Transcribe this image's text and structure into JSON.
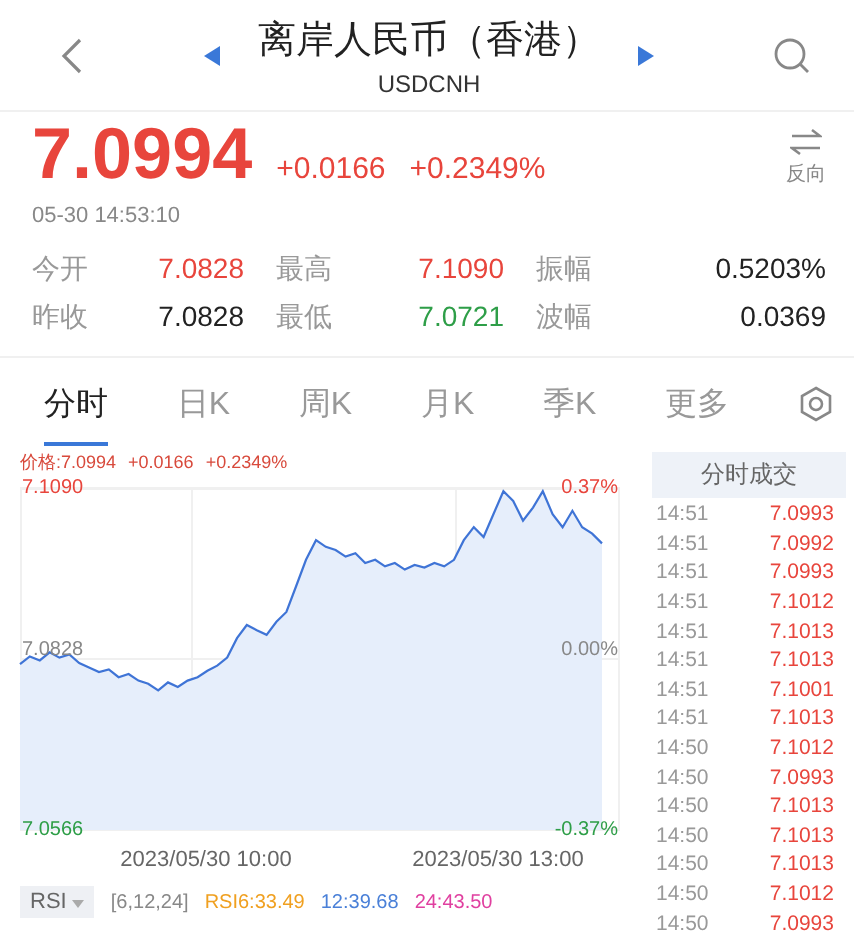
{
  "header": {
    "title": "离岸人民币（香港）",
    "code": "USDCNH"
  },
  "quote": {
    "price": "7.0994",
    "change": "+0.0166",
    "change_pct": "+0.2349%",
    "time": "05-30 14:53:10",
    "reverse_label": "反向"
  },
  "stats": [
    {
      "label": "今开",
      "value": "7.0828",
      "color": "#e8453c"
    },
    {
      "label": "最高",
      "value": "7.1090",
      "color": "#e8453c"
    },
    {
      "label": "振幅",
      "value": "0.5203%",
      "color": "#222222"
    },
    {
      "label": "昨收",
      "value": "7.0828",
      "color": "#222222"
    },
    {
      "label": "最低",
      "value": "7.0721",
      "color": "#2e9e48"
    },
    {
      "label": "波幅",
      "value": "0.0369",
      "color": "#222222"
    }
  ],
  "tabs": [
    {
      "label": "分时",
      "selected": true
    },
    {
      "label": "日K",
      "selected": false
    },
    {
      "label": "周K",
      "selected": false
    },
    {
      "label": "月K",
      "selected": false
    },
    {
      "label": "季K",
      "selected": false
    },
    {
      "label": "更多",
      "selected": false
    }
  ],
  "chart": {
    "info": "价格:7.0994",
    "info_change": "+0.0166",
    "info_pct": "+0.2349%",
    "high_pct": "0.37%",
    "mid_pct": "0.00%",
    "low_pct": "-0.37%",
    "time_labels": [
      "2023/05/30 10:00",
      "2023/05/30 13:00"
    ],
    "chart_data": {
      "type": "area",
      "ylim": [
        7.0566,
        7.109
      ],
      "yticks": [
        {
          "value": 7.0566,
          "label": "7.0566"
        },
        {
          "value": 7.0828,
          "label": "7.0828"
        },
        {
          "value": 7.109,
          "label": "7.1090"
        }
      ],
      "series": [
        {
          "color": "#3f74d6",
          "values": [
            7.082,
            7.0832,
            7.0826,
            7.0838,
            7.083,
            7.0835,
            7.0822,
            7.0815,
            7.0808,
            7.0812,
            7.08,
            7.0805,
            7.0795,
            7.079,
            7.078,
            7.0792,
            7.0785,
            7.0795,
            7.08,
            7.081,
            7.0818,
            7.083,
            7.086,
            7.088,
            7.0872,
            7.0865,
            7.0885,
            7.09,
            7.094,
            7.098,
            7.101,
            7.1,
            7.0995,
            7.0985,
            7.099,
            7.0975,
            7.098,
            7.097,
            7.0975,
            7.0965,
            7.0972,
            7.0968,
            7.0975,
            7.097,
            7.098,
            7.101,
            7.103,
            7.1015,
            7.105,
            7.1085,
            7.107,
            7.104,
            7.106,
            7.1085,
            7.105,
            7.103,
            7.1055,
            7.103,
            7.102,
            7.1005
          ]
        }
      ]
    }
  },
  "rsi": {
    "button": "RSI",
    "params": "[6,12,24]",
    "values": [
      {
        "text": "RSI6:33.49",
        "color": "#f0a020"
      },
      {
        "text": "12:39.68",
        "color": "#4a80d8"
      },
      {
        "text": "24:43.50",
        "color": "#e040a0"
      }
    ]
  },
  "trades": {
    "title": "分时成交",
    "rows": [
      {
        "time": "14:51",
        "price": "7.0993"
      },
      {
        "time": "14:51",
        "price": "7.0992"
      },
      {
        "time": "14:51",
        "price": "7.0993"
      },
      {
        "time": "14:51",
        "price": "7.1012"
      },
      {
        "time": "14:51",
        "price": "7.1013"
      },
      {
        "time": "14:51",
        "price": "7.1013"
      },
      {
        "time": "14:51",
        "price": "7.1001"
      },
      {
        "time": "14:51",
        "price": "7.1013"
      },
      {
        "time": "14:50",
        "price": "7.1012"
      },
      {
        "time": "14:50",
        "price": "7.0993"
      },
      {
        "time": "14:50",
        "price": "7.1013"
      },
      {
        "time": "14:50",
        "price": "7.1013"
      },
      {
        "time": "14:50",
        "price": "7.1013"
      },
      {
        "time": "14:50",
        "price": "7.1012"
      },
      {
        "time": "14:50",
        "price": "7.0993"
      }
    ]
  }
}
